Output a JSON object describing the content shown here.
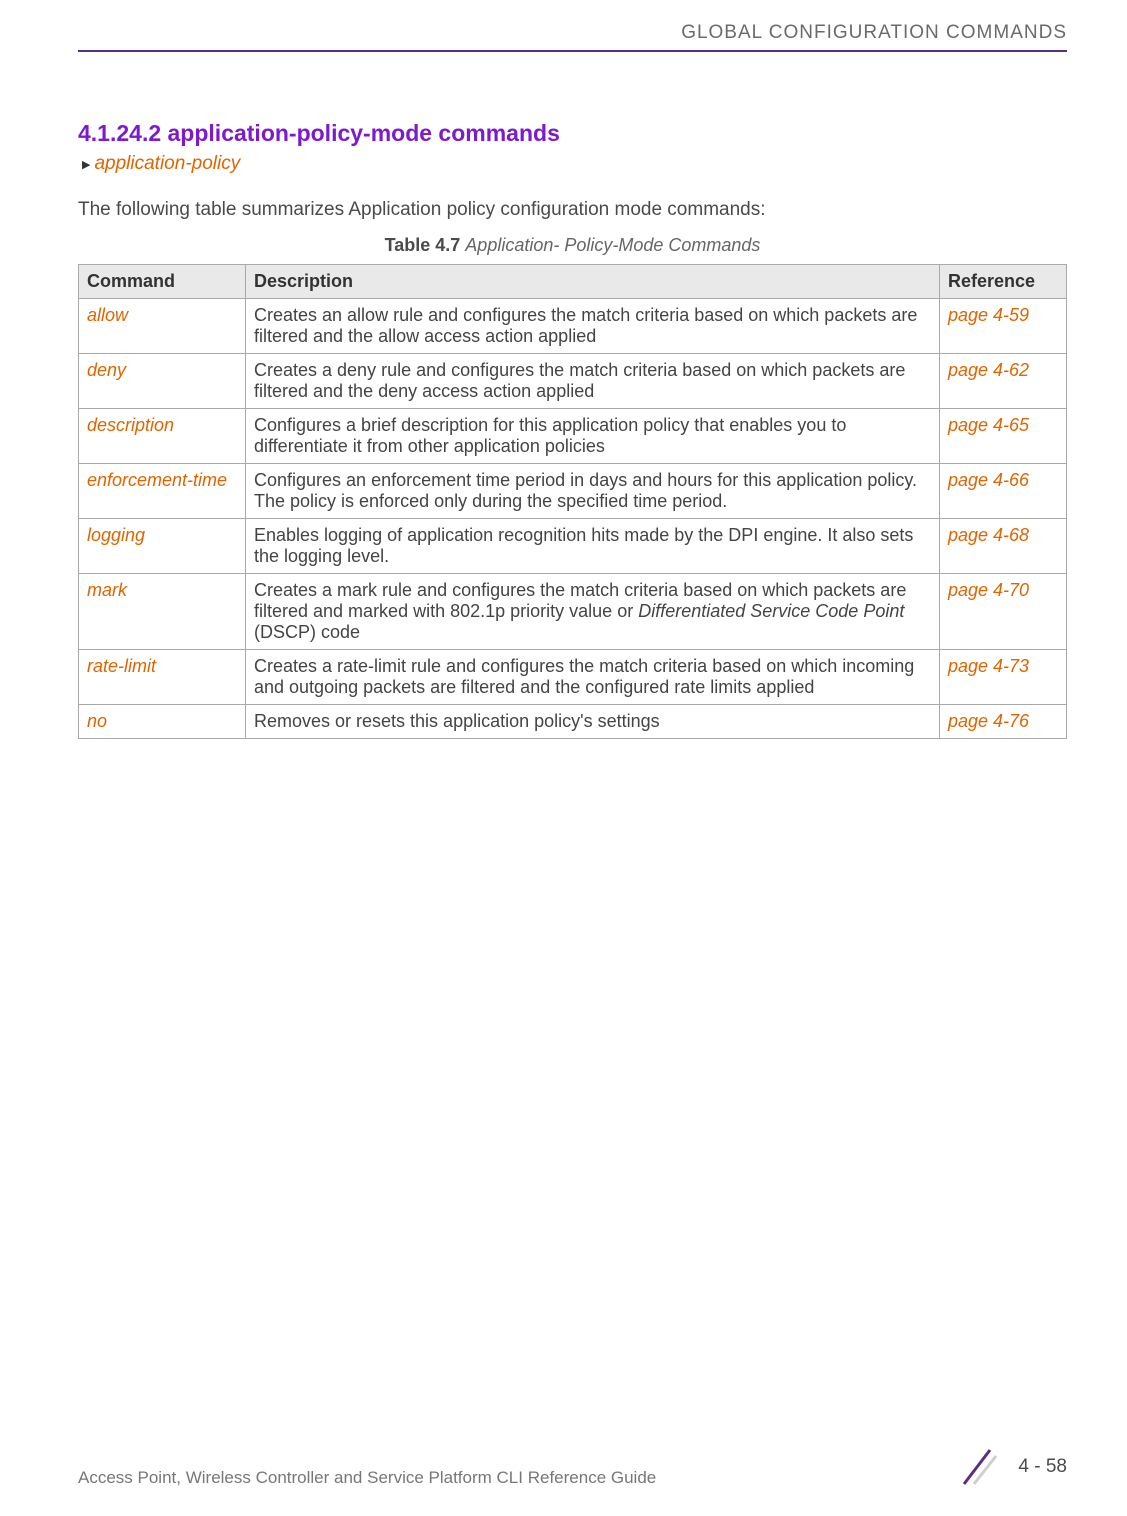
{
  "header": {
    "running_title": "GLOBAL CONFIGURATION COMMANDS"
  },
  "section": {
    "number_title": "4.1.24.2 application-policy-mode commands",
    "breadcrumb_link": "application-policy",
    "intro": "The following table summarizes Application policy configuration mode commands:",
    "caption_label": "Table 4.7",
    "caption_text": "Application- Policy-Mode Commands"
  },
  "table": {
    "headers": {
      "c0": "Command",
      "c1": "Description",
      "c2": "Reference"
    },
    "rows": [
      {
        "command": "allow",
        "description": "Creates an allow rule and configures the match criteria based on which packets are filtered and the allow access action applied",
        "reference": "page 4-59"
      },
      {
        "command": "deny",
        "description": "Creates a deny rule and configures the match criteria based on which packets are filtered and the deny access action applied",
        "reference": "page 4-62"
      },
      {
        "command": "description",
        "description": "Configures a brief description for this application policy that enables you to differentiate it from other application policies",
        "reference": "page 4-65"
      },
      {
        "command": "enforcement-time",
        "description": "Configures an enforcement time period in days and hours for this application policy. The policy is enforced only during the specified time period.",
        "reference": "page 4-66"
      },
      {
        "command": "logging",
        "description": "Enables logging of application recognition hits made by the DPI engine. It also sets the logging level.",
        "reference": "page 4-68"
      },
      {
        "command": "mark",
        "description_pre": "Creates a mark rule and configures the match criteria based on which packets are filtered and marked with 802.1p priority value or ",
        "description_em": "Differentiated Service Code Point",
        "description_post": " (DSCP) code",
        "reference": "page 4-70"
      },
      {
        "command": "rate-limit",
        "description": "Creates a rate-limit rule and configures the match criteria based on which incoming and outgoing packets are filtered and the configured rate limits applied",
        "reference": "page 4-73"
      },
      {
        "command": "no",
        "description": "Removes or resets this application policy's settings",
        "reference": "page 4-76"
      }
    ]
  },
  "footer": {
    "guide_title": "Access Point, Wireless Controller and Service Platform CLI Reference Guide",
    "page_number": "4 - 58"
  }
}
